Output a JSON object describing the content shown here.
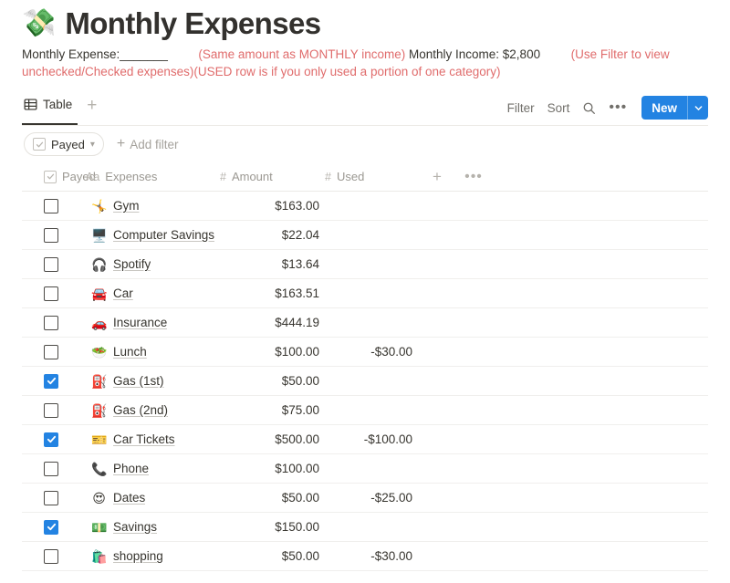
{
  "page": {
    "title_emoji": "💸",
    "title": "Monthly Expenses",
    "description": {
      "seg1_black": "Monthly Expense:_______",
      "seg2_red": "(Same amount as MONTHLY income)",
      "seg3_black": "Monthly Income: $2,800",
      "seg4_red": "(Use Filter to view unchecked/Checked expenses)(USED row is if you only used a portion of one category)"
    }
  },
  "view_bar": {
    "tab_label": "Table",
    "tab_icon": "table-icon",
    "add_view_icon": "plus-icon",
    "filter_label": "Filter",
    "sort_label": "Sort",
    "search_icon": "search-icon",
    "more_icon": "ellipsis-icon",
    "new_label": "New",
    "new_caret_icon": "chevron-down-icon"
  },
  "filter_bar": {
    "chip_label": "Payed",
    "chip_icon": "checkbox-icon",
    "chip_caret": "chevron-down-icon",
    "add_filter_label": "Add filter",
    "add_filter_icon": "plus-icon"
  },
  "table": {
    "columns": [
      {
        "label": "Payed",
        "type_icon": "checkbox-icon"
      },
      {
        "label": "Expenses",
        "type_icon": "Aa"
      },
      {
        "label": "Amount",
        "type_icon": "#"
      },
      {
        "label": "Used",
        "type_icon": "#"
      }
    ],
    "add_column_icon": "plus-icon",
    "options_icon": "ellipsis-icon",
    "rows": [
      {
        "payed": false,
        "emoji": "🤸",
        "name": "Gym",
        "amount": "$163.00",
        "used": ""
      },
      {
        "payed": false,
        "emoji": "🖥️",
        "name": "Computer Savings",
        "amount": "$22.04",
        "used": ""
      },
      {
        "payed": false,
        "emoji": "🎧",
        "name": "Spotify",
        "amount": "$13.64",
        "used": ""
      },
      {
        "payed": false,
        "emoji": "🚘",
        "name": "Car",
        "amount": "$163.51",
        "used": ""
      },
      {
        "payed": false,
        "emoji": "🚗",
        "name": "Insurance",
        "amount": "$444.19",
        "used": ""
      },
      {
        "payed": false,
        "emoji": "🥗",
        "name": "Lunch",
        "amount": "$100.00",
        "used": "-$30.00"
      },
      {
        "payed": true,
        "emoji": "⛽",
        "name": "Gas (1st)",
        "amount": "$50.00",
        "used": ""
      },
      {
        "payed": false,
        "emoji": "⛽",
        "name": "Gas (2nd)",
        "amount": "$75.00",
        "used": ""
      },
      {
        "payed": true,
        "emoji": "🎫",
        "name": "Car Tickets",
        "amount": "$500.00",
        "used": "-$100.00"
      },
      {
        "payed": false,
        "emoji": "📞",
        "name": "Phone",
        "amount": "$100.00",
        "used": ""
      },
      {
        "payed": false,
        "emoji": "😍",
        "name": "Dates",
        "amount": "$50.00",
        "used": "-$25.00"
      },
      {
        "payed": true,
        "emoji": "💵",
        "name": "Savings",
        "amount": "$150.00",
        "used": ""
      },
      {
        "payed": false,
        "emoji": "🛍️",
        "name": "shopping",
        "amount": "$50.00",
        "used": "-$30.00"
      }
    ]
  },
  "colors": {
    "accent_blue": "#2383e2",
    "note_red": "#e06c6c",
    "text": "#37352f"
  }
}
